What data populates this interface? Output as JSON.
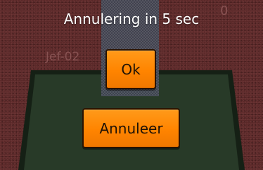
{
  "game": {
    "opponent_name": "Jef-02",
    "score": "0"
  },
  "dialog": {
    "countdown_text": "Annulering in 5 sec",
    "ok_label": "Ok",
    "cancel_label": "Annuleer"
  },
  "colors": {
    "background": "#5a2828",
    "table_felt": "#283a28",
    "table_border": "#152015",
    "button": "#ff8400",
    "button_text": "#1e1206",
    "countdown_text": "#ffffff"
  }
}
